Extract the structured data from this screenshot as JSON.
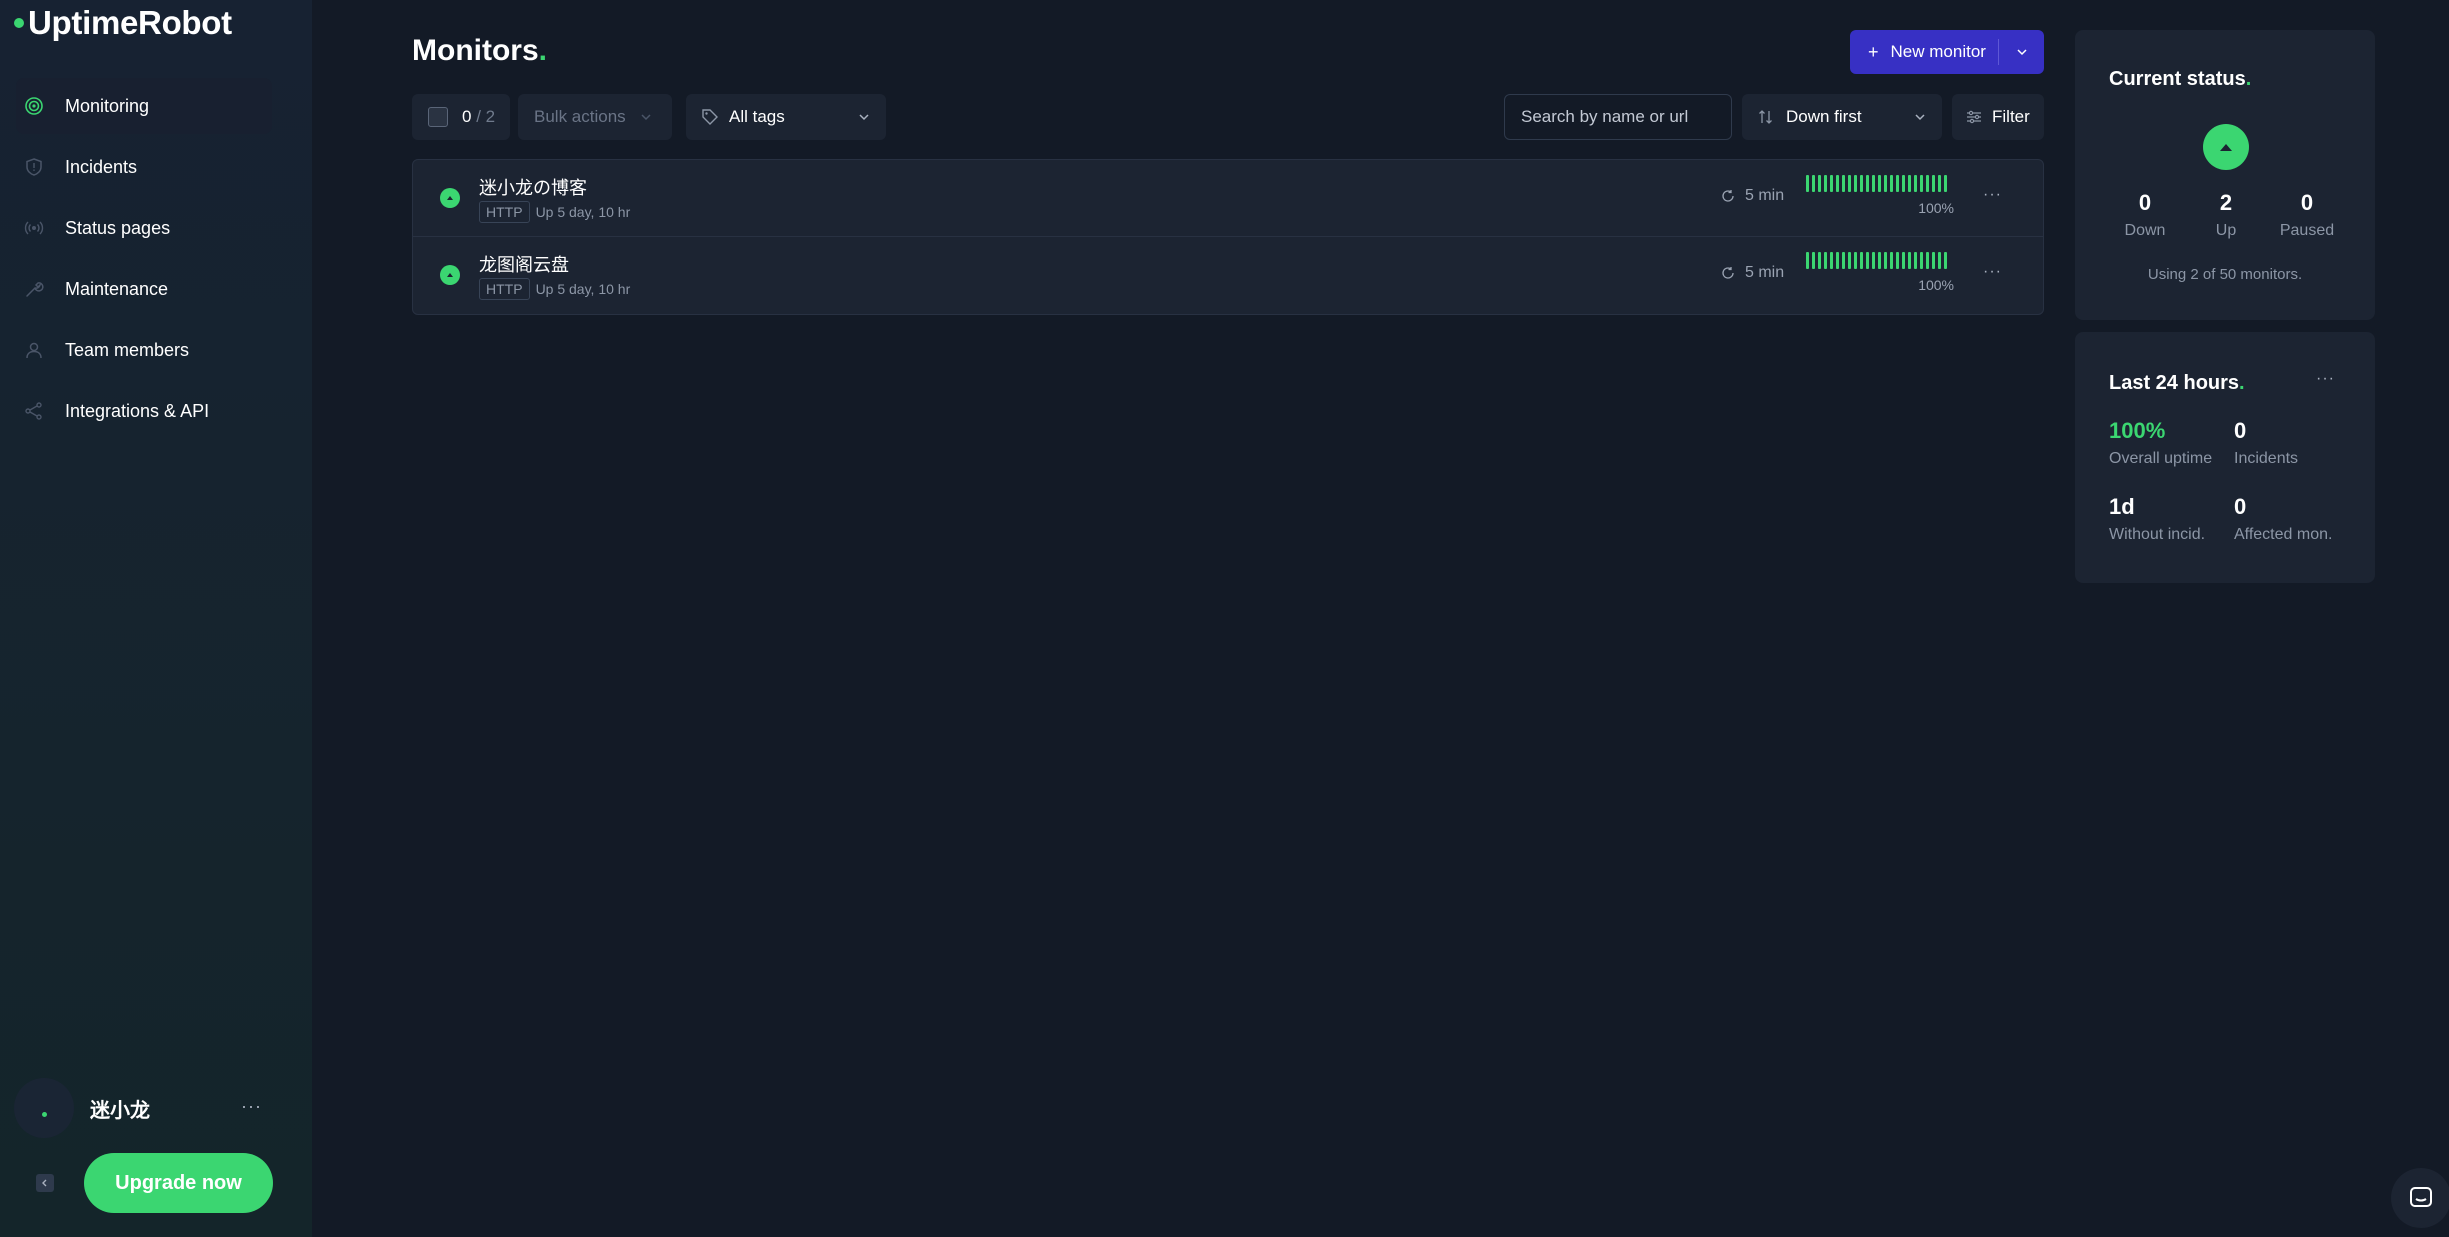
{
  "app": {
    "logo": "UptimeRobot"
  },
  "sidebar": {
    "items": [
      {
        "label": "Monitoring",
        "icon": "target-icon"
      },
      {
        "label": "Incidents",
        "icon": "shield-icon"
      },
      {
        "label": "Status pages",
        "icon": "broadcast-icon"
      },
      {
        "label": "Maintenance",
        "icon": "wrench-icon"
      },
      {
        "label": "Team members",
        "icon": "user-icon"
      },
      {
        "label": "Integrations & API",
        "icon": "share-icon"
      }
    ],
    "user_name": "迷小龙",
    "user_menu": "···",
    "upgrade_label": "Upgrade now"
  },
  "header": {
    "title": "Monitors",
    "title_dot": ".",
    "new_monitor_label": "New monitor"
  },
  "toolbar": {
    "selected": "0",
    "total": " / 2",
    "bulk_actions": "Bulk actions",
    "tags": "All tags",
    "search_placeholder": "Search by name or url",
    "sort": "Down first",
    "filter": "Filter"
  },
  "monitors": [
    {
      "name": "迷小龙の博客",
      "type": "HTTP",
      "uptime_text": "Up 5 day, 10 hr",
      "interval": "5 min",
      "uptime_pct": "100%",
      "menu": "···"
    },
    {
      "name": "龙图阁云盘",
      "type": "HTTP",
      "uptime_text": "Up 5 day, 10 hr",
      "interval": "5 min",
      "uptime_pct": "100%",
      "menu": "···"
    }
  ],
  "current_status": {
    "title": "Current status",
    "title_dot": ".",
    "down": "0",
    "down_label": "Down",
    "up": "2",
    "up_label": "Up",
    "paused": "0",
    "paused_label": "Paused",
    "usage": "Using 2 of 50 monitors."
  },
  "last24": {
    "title": "Last 24 hours",
    "title_dot": ".",
    "menu": "···",
    "uptime": "100%",
    "uptime_label": "Overall uptime",
    "incidents": "0",
    "incidents_label": "Incidents",
    "without": "1d",
    "without_label": "Without incid.",
    "affected": "0",
    "affected_label": "Affected mon."
  },
  "colors": {
    "accent_green": "#3bd671",
    "primary_button": "#3730c4",
    "background": "#131a26",
    "panel": "#1c2432"
  }
}
